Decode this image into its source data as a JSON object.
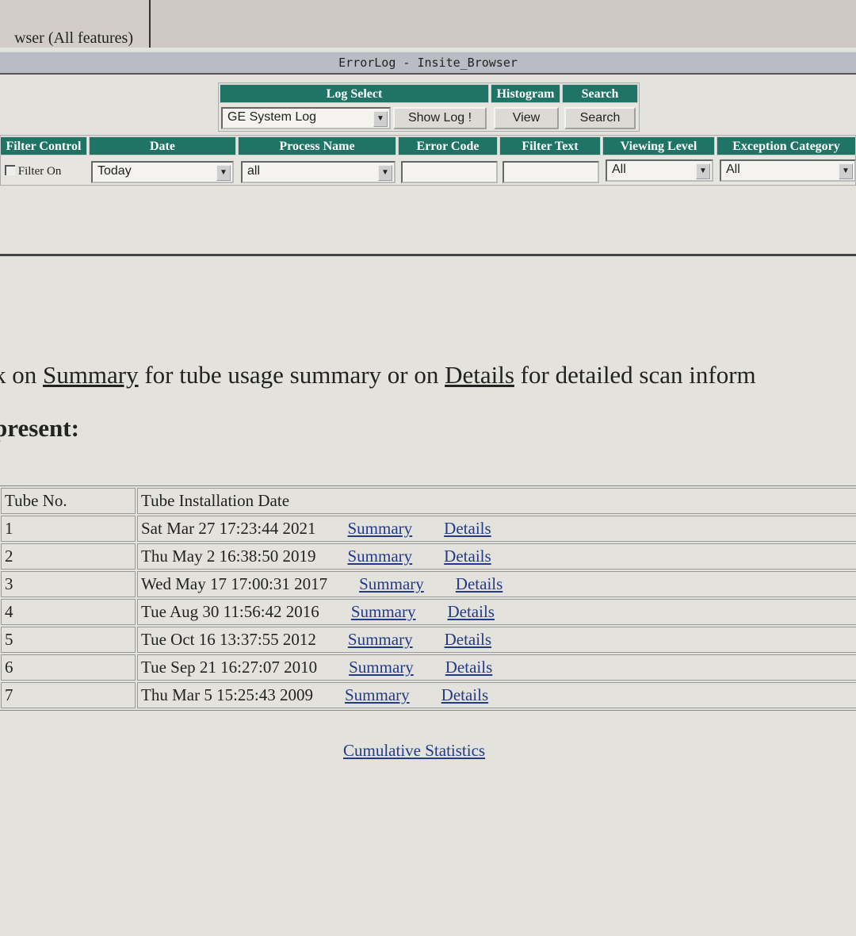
{
  "background_tab": {
    "label": "wser (All features)"
  },
  "window_title": "ErrorLog - Insite_Browser",
  "toolbar": {
    "log_select_header": "Log Select",
    "histogram_header": "Histogram",
    "search_header": "Search",
    "log_select_value": "GE System Log",
    "show_log_button": "Show Log !",
    "view_button": "View",
    "search_button": "Search"
  },
  "filters": {
    "headers": [
      "Filter Control",
      "Date",
      "Process Name",
      "Error Code",
      "Filter Text",
      "Viewing Level",
      "Exception Category"
    ],
    "filter_on_label": "Filter On",
    "filter_on_checked": false,
    "date_value": "Today",
    "process_value": "all",
    "error_code_value": "",
    "filter_text_value": "",
    "viewing_level_value": "All",
    "exception_category_value": "All"
  },
  "intro": {
    "pre": "k on ",
    "summary_link": "Summary",
    "mid": " for tube usage summary or on ",
    "details_link": "Details",
    "post": " for detailed scan inform"
  },
  "present_heading": "present:",
  "tube_table": {
    "headers": [
      "Tube No.",
      "Tube Installation Date"
    ],
    "rows": [
      {
        "no": "1",
        "date": "Sat Mar 27 17:23:44 2021",
        "summary": "Summary",
        "details": "Details"
      },
      {
        "no": "2",
        "date": "Thu May 2 16:38:50 2019",
        "summary": "Summary",
        "details": "Details"
      },
      {
        "no": "3",
        "date": "Wed May 17 17:00:31 2017",
        "summary": "Summary",
        "details": "Details"
      },
      {
        "no": "4",
        "date": "Tue Aug 30 11:56:42 2016",
        "summary": "Summary",
        "details": "Details"
      },
      {
        "no": "5",
        "date": "Tue Oct 16 13:37:55 2012",
        "summary": "Summary",
        "details": "Details"
      },
      {
        "no": "6",
        "date": "Tue Sep 21 16:27:07 2010",
        "summary": "Summary",
        "details": "Details"
      },
      {
        "no": "7",
        "date": "Thu Mar 5 15:25:43 2009",
        "summary": "Summary",
        "details": "Details"
      }
    ]
  },
  "cumulative_link": "Cumulative Statistics",
  "colors": {
    "header_bg": "#1f7466",
    "link": "#223a8a",
    "page_bg": "#e4e2dc"
  }
}
